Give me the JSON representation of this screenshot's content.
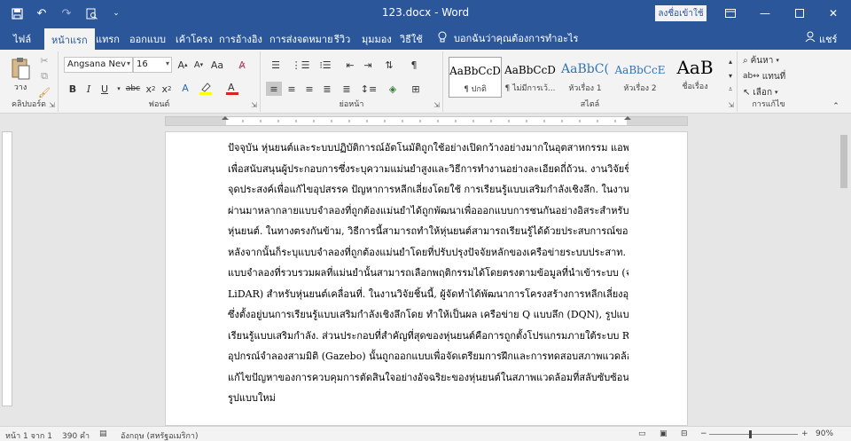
{
  "titlebar": {
    "title": "123.docx - Word",
    "signin_label": "ลงชื่อเข้าใช้",
    "accent": "#2b579a"
  },
  "tabs": [
    {
      "label": "ไฟล์"
    },
    {
      "label": "หน้าแรก",
      "active": true
    },
    {
      "label": "แทรก"
    },
    {
      "label": "ออกแบบ"
    },
    {
      "label": "เค้าโครง"
    },
    {
      "label": "การอ้างอิง"
    },
    {
      "label": "การส่งจดหมาย"
    },
    {
      "label": "รีวิว"
    },
    {
      "label": "มุมมอง"
    },
    {
      "label": "วิธีใช้"
    }
  ],
  "tellme": {
    "icon": "lightbulb-icon",
    "text": "บอกฉันว่าคุณต้องการทำอะไร"
  },
  "user": {
    "label": "แชร์"
  },
  "ribbon": {
    "clipboard": {
      "paste_label": "วาง",
      "group_label": "คลิปบอร์ด"
    },
    "font": {
      "font_name": "Angsana Nev",
      "font_size": "16",
      "group_label": "ฟอนต์"
    },
    "paragraph": {
      "group_label": "ย่อหน้า"
    },
    "styles": {
      "group_label": "สไตล์",
      "items": [
        {
          "sample": "AaBbCcD",
          "name": "¶ ปกติ"
        },
        {
          "sample": "AaBbCcD",
          "name": "¶ ไม่มีการเว้..."
        },
        {
          "sample": "AaBbC(",
          "name": "หัวเรื่อง 1"
        },
        {
          "sample": "AaBbCcE",
          "name": "หัวเรื่อง 2"
        },
        {
          "sample": "AaB",
          "name": "ชื่อเรื่อง"
        }
      ]
    },
    "editing": {
      "find_label": "ค้นหา",
      "replace_label": "แทนที่",
      "select_label": "เลือก",
      "group_label": "การแก้ไข"
    }
  },
  "document": {
    "lines": [
      "ปัจจุบัน หุ่นยนต์และระบบปฏิบัติการณ์อัตโนมัติถูกใช้อย่างเปิดกว้างอย่างมากในอุตสาหกรรม แอพพลิเคชั่น",
      "เพื่อสนับสนุนผู้ประกอบการซึ่งระบุความแม่นยำสูงและวิธีการทำงานอย่างละเอียดถี่ถ้วน. งานวิจัยชิ้นนี้มี",
      "จุดประสงค์เพื่อแก้ไขอุปสรรค ปัญหาการหลีกเลี่ยงโดยใช้ การเรียนรู้แบบเสริมกำลังเชิงลึก. ในงานวิจัยที่",
      "ผ่านมาหลากลายแบบจำลองที่ถูกต้องแม่นยำได้ถูกพัฒนาเพื่อออกแบบการชนกันอย่างอิสระสำหรับ",
      "หุ่นยนต์. ในทางตรงกันข้าม, วิธีการนี้สามารถทำให้หุ่นยนต์สามารถเรียนรู้ได้ด้วยประสบการณ์ของมันเอง,",
      "หลังจากนั้นก็ระบุแบบจำลองที่ถูกต้องแม่นยำโดยที่ปรับปรุงปัจจัยหลักของเครือข่ายระบบประสาท.",
      "แบบจำลองที่รวบรวมผลที่แม่นยำนั้นสามารถเลือกพฤติกรรมได้โดยตรงตามข้อมูลที่นำเข้าระบบ (จาก",
      "LiDAR) สำหรับหุ่นยนต์เคลื่อนที่. ในงานวิจัยชิ้นนี้, ผู้จัดทำได้พัฒนาการโครงสร้างการหลีกเลี่ยงอุปสรรค",
      "ซึ่งตั้งอยู่บนการเรียนรู้แบบเสริมกำลังเชิงลึกโดย ทำให้เป็นผล เครือข่าย Q แบบลึก (DQN), รูปแบบของการ",
      "เรียนรู้แบบเสริมกำลัง. ส่วนประกอบที่สำคัญที่สุดของหุ่นยนต์คือการถูกตั้งโปรแกรมภายใต้ระบบ ROS.",
      "อุปกรณ์จำลองสามมิติ (Gazebo) นั้นถูกออกแบบเพื่อจัดเตรียมการฝึกและการทดสอบสภาพแวดล้อม, เพื่อ",
      "แก้ไขปัญหาของการควบคุมการตัดสินใจอย่างอัจฉริยะของหุ่นยนต์ในสภาพแวดล้อมที่สลับซับซ้อน",
      "รูปแบบใหม่"
    ]
  },
  "statusbar": {
    "page": "หน้า 1 จาก 1",
    "words": "390 คำ",
    "language": "อังกฤษ (สหรัฐอเมริกา)",
    "zoom": "90%"
  }
}
